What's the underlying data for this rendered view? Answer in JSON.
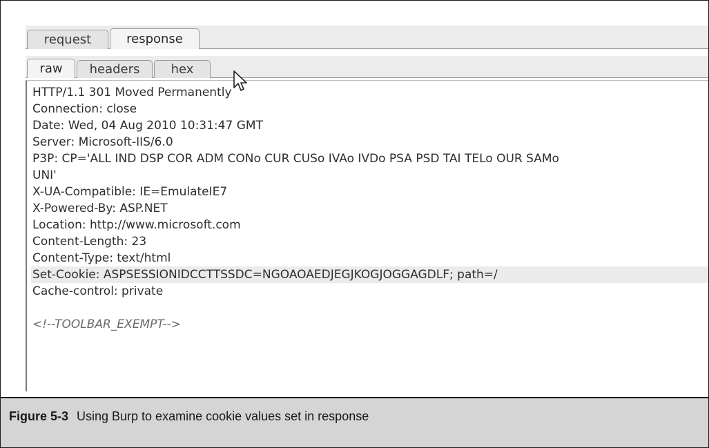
{
  "tabs": {
    "outer": [
      {
        "label": "request",
        "active": false
      },
      {
        "label": "response",
        "active": true
      }
    ],
    "inner": [
      {
        "label": "raw",
        "active": true
      },
      {
        "label": "headers",
        "active": false
      },
      {
        "label": "hex",
        "active": false
      }
    ]
  },
  "response": {
    "lines": [
      "HTTP/1.1 301 Moved Permanently",
      "Connection: close",
      "Date: Wed, 04 Aug 2010 10:31:47 GMT",
      "Server: Microsoft-IIS/6.0",
      "P3P: CP='ALL IND DSP COR ADM CONo CUR CUSo IVAo IVDo PSA PSD TAI TELo OUR SAMo",
      "UNI'",
      "X-UA-Compatible: IE=EmulateIE7",
      "X-Powered-By: ASP.NET",
      "Location: http://www.microsoft.com",
      "Content-Length: 23",
      "Content-Type: text/html",
      "Set-Cookie: ASPSESSIONIDCCTTSSDC=NGOAOAEDJEGJKOGJOGGAGDLF; path=/",
      "Cache-control: private",
      "",
      "<!--TOOLBAR_EXEMPT-->"
    ],
    "highlighted_line": 11
  },
  "caption": {
    "number": "Figure 5-3",
    "text": "Using Burp to examine cookie values set in response"
  },
  "icons": {
    "pointer": "mouse-pointer-icon"
  }
}
